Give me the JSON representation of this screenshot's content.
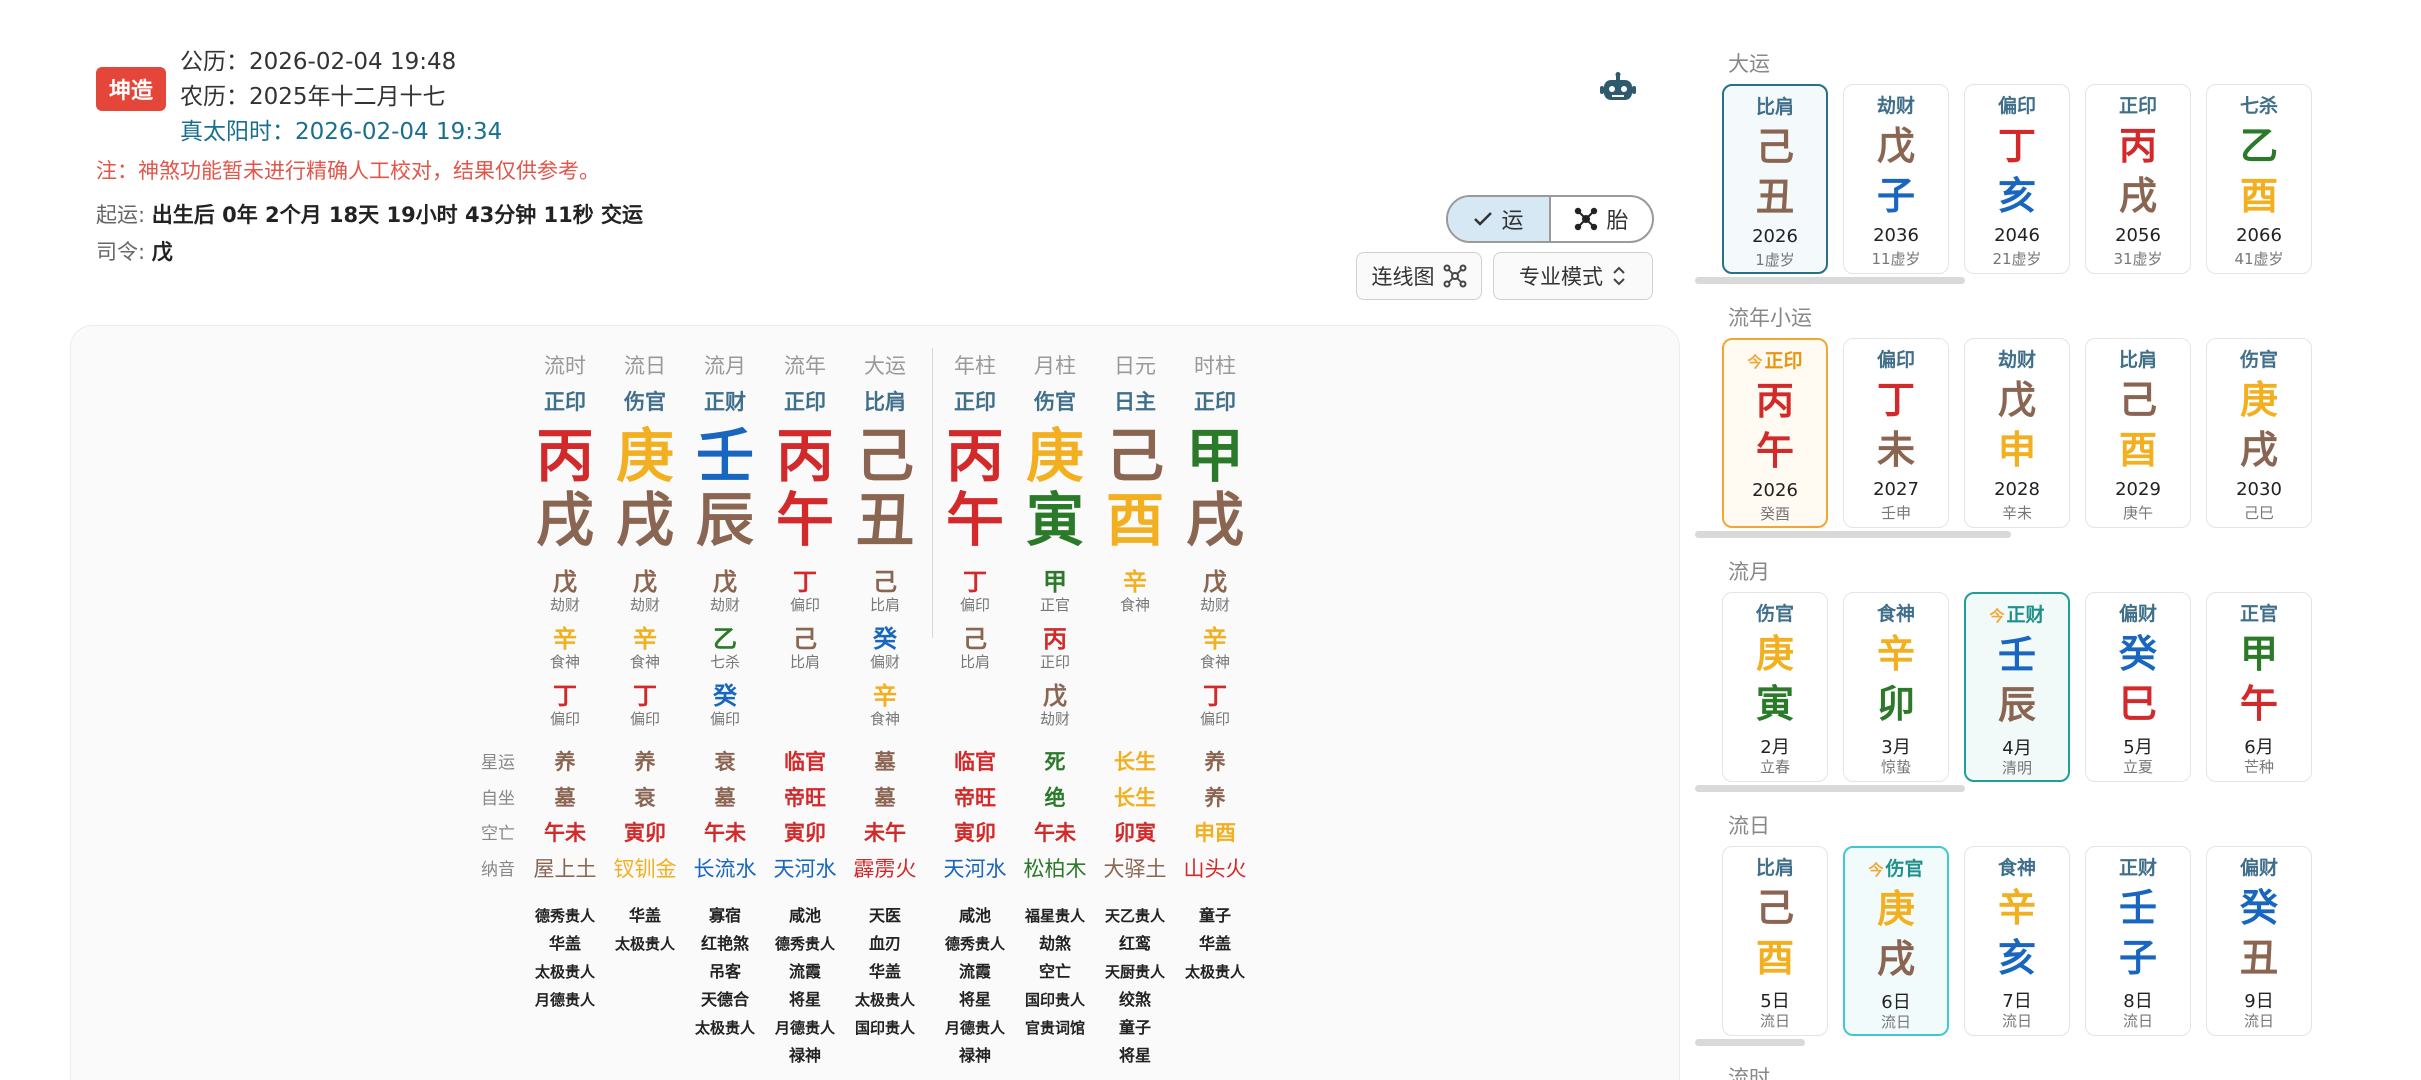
{
  "header": {
    "badge": "坤造",
    "solar": "公历：2026-02-04 19:48",
    "lunar": "农历：2025年十二月十七",
    "true_solar": "真太阳时：2026-02-04 19:34",
    "note": "注：神煞功能暂未进行精确人工校对，结果仅供参考。",
    "qiyun_label": "起运:",
    "qiyun_value": "出生后 0年 2个月 18天 19小时 43分钟 11秒 交运",
    "siling_label": "司令:",
    "siling_value": "戊",
    "robot_icon": "robot-icon",
    "toggle": {
      "yun": "运",
      "tai": "胎"
    },
    "lianxian_label": "连线图",
    "mode_label": "专业模式"
  },
  "chart": {
    "columns": [
      {
        "hdr": "流时",
        "ten": "正印",
        "gan": "丙",
        "gan_c": "fire",
        "zhi": "戌",
        "zhi_c": "earth",
        "hidden": [
          {
            "c": "戊",
            "t": "劫财",
            "e": "earth"
          },
          {
            "c": "辛",
            "t": "食神",
            "e": "metal"
          },
          {
            "c": "丁",
            "t": "偏印",
            "e": "fire"
          }
        ],
        "xingyun": "养",
        "xy_c": "earth",
        "zizuo": "墓",
        "zz_c": "earth",
        "kong": "午未",
        "nayin": "屋上土",
        "ny_c": "earth",
        "shensha": [
          "德秀贵人",
          "华盖",
          "太极贵人",
          "月德贵人"
        ]
      },
      {
        "hdr": "流日",
        "ten": "伤官",
        "gan": "庚",
        "gan_c": "metal",
        "zhi": "戌",
        "zhi_c": "earth",
        "hidden": [
          {
            "c": "戊",
            "t": "劫财",
            "e": "earth"
          },
          {
            "c": "辛",
            "t": "食神",
            "e": "metal"
          },
          {
            "c": "丁",
            "t": "偏印",
            "e": "fire"
          }
        ],
        "xingyun": "养",
        "xy_c": "earth",
        "zizuo": "衰",
        "zz_c": "earth",
        "kong": "寅卯",
        "nayin": "钗钏金",
        "ny_c": "metal",
        "shensha": [
          "华盖",
          "太极贵人"
        ]
      },
      {
        "hdr": "流月",
        "ten": "正财",
        "gan": "壬",
        "gan_c": "water",
        "zhi": "辰",
        "zhi_c": "earth",
        "hidden": [
          {
            "c": "戊",
            "t": "劫财",
            "e": "earth"
          },
          {
            "c": "乙",
            "t": "七杀",
            "e": "wood"
          },
          {
            "c": "癸",
            "t": "偏印",
            "e": "water"
          }
        ],
        "xingyun": "衰",
        "xy_c": "earth",
        "zizuo": "墓",
        "zz_c": "earth",
        "kong": "午未",
        "nayin": "长流水",
        "ny_c": "water",
        "shensha": [
          "寡宿",
          "红艳煞",
          "吊客",
          "天德合",
          "太极贵人"
        ]
      },
      {
        "hdr": "流年",
        "ten": "正印",
        "gan": "丙",
        "gan_c": "fire",
        "zhi": "午",
        "zhi_c": "fire",
        "hidden": [
          {
            "c": "丁",
            "t": "偏印",
            "e": "fire"
          },
          {
            "c": "己",
            "t": "比肩",
            "e": "earth"
          }
        ],
        "xingyun": "临官",
        "xy_c": "fire",
        "zizuo": "帝旺",
        "zz_c": "fire",
        "kong": "寅卯",
        "nayin": "天河水",
        "ny_c": "water",
        "shensha": [
          "咸池",
          "德秀贵人",
          "流霞",
          "将星",
          "月德贵人",
          "禄神"
        ]
      },
      {
        "hdr": "大运",
        "ten": "比肩",
        "gan": "己",
        "gan_c": "earth",
        "zhi": "丑",
        "zhi_c": "earth",
        "hidden": [
          {
            "c": "己",
            "t": "比肩",
            "e": "earth"
          },
          {
            "c": "癸",
            "t": "偏财",
            "e": "water"
          },
          {
            "c": "辛",
            "t": "食神",
            "e": "metal"
          }
        ],
        "xingyun": "墓",
        "xy_c": "earth",
        "zizuo": "墓",
        "zz_c": "earth",
        "kong": "未午",
        "nayin": "霹雳火",
        "ny_c": "fire",
        "shensha": [
          "天医",
          "血刃",
          "华盖",
          "太极贵人",
          "国印贵人"
        ]
      },
      {
        "hdr": "年柱",
        "ten": "正印",
        "gan": "丙",
        "gan_c": "fire",
        "zhi": "午",
        "zhi_c": "fire",
        "hidden": [
          {
            "c": "丁",
            "t": "偏印",
            "e": "fire"
          },
          {
            "c": "己",
            "t": "比肩",
            "e": "earth"
          }
        ],
        "xingyun": "临官",
        "xy_c": "fire",
        "zizuo": "帝旺",
        "zz_c": "fire",
        "kong": "寅卯",
        "nayin": "天河水",
        "ny_c": "water",
        "shensha": [
          "咸池",
          "德秀贵人",
          "流霞",
          "将星",
          "月德贵人",
          "禄神"
        ]
      },
      {
        "hdr": "月柱",
        "ten": "伤官",
        "gan": "庚",
        "gan_c": "metal",
        "zhi": "寅",
        "zhi_c": "wood",
        "hidden": [
          {
            "c": "甲",
            "t": "正官",
            "e": "wood"
          },
          {
            "c": "丙",
            "t": "正印",
            "e": "fire"
          },
          {
            "c": "戊",
            "t": "劫财",
            "e": "earth"
          }
        ],
        "xingyun": "死",
        "xy_c": "wood",
        "zizuo": "绝",
        "zz_c": "wood",
        "kong": "午未",
        "nayin": "松柏木",
        "ny_c": "wood",
        "shensha": [
          "福星贵人",
          "劫煞",
          "空亡",
          "国印贵人",
          "官贵词馆"
        ]
      },
      {
        "hdr": "日元",
        "ten": "日主",
        "gan": "己",
        "gan_c": "earth",
        "zhi": "酉",
        "zhi_c": "metal",
        "hidden": [
          {
            "c": "辛",
            "t": "食神",
            "e": "metal"
          }
        ],
        "xingyun": "长生",
        "xy_c": "metal",
        "zizuo": "长生",
        "zz_c": "metal",
        "kong": "卯寅",
        "nayin": "大驿土",
        "ny_c": "earth",
        "shensha": [
          "天乙贵人",
          "红鸾",
          "天厨贵人",
          "绞煞",
          "童子",
          "将星"
        ]
      },
      {
        "hdr": "时柱",
        "ten": "正印",
        "gan": "甲",
        "gan_c": "wood",
        "zhi": "戌",
        "zhi_c": "earth",
        "hidden": [
          {
            "c": "戊",
            "t": "劫财",
            "e": "earth"
          },
          {
            "c": "辛",
            "t": "食神",
            "e": "metal"
          },
          {
            "c": "丁",
            "t": "偏印",
            "e": "fire"
          }
        ],
        "xingyun": "养",
        "xy_c": "earth",
        "zizuo": "养",
        "zz_c": "earth",
        "kong": "申酉",
        "nayin": "山头火",
        "ny_c": "fire",
        "shensha": [
          "童子",
          "华盖",
          "太极贵人"
        ]
      }
    ],
    "row_labels": {
      "xingyun": "星运",
      "zizuo": "自坐",
      "kong": "空亡",
      "nayin": "纳音"
    }
  },
  "sections": [
    {
      "title": "大运",
      "cards": [
        {
          "ten": "比肩",
          "g1": "己",
          "g1_c": "earth",
          "g2": "丑",
          "g2_c": "earth",
          "yr": "2026",
          "sub": "1虚岁",
          "state": "sel"
        },
        {
          "ten": "劫财",
          "g1": "戊",
          "g1_c": "earth",
          "g2": "子",
          "g2_c": "water",
          "yr": "2036",
          "sub": "11虚岁",
          "state": ""
        },
        {
          "ten": "偏印",
          "g1": "丁",
          "g1_c": "fire",
          "g2": "亥",
          "g2_c": "water",
          "yr": "2046",
          "sub": "21虚岁",
          "state": ""
        },
        {
          "ten": "正印",
          "g1": "丙",
          "g1_c": "fire",
          "g2": "戌",
          "g2_c": "earth",
          "yr": "2056",
          "sub": "31虚岁",
          "state": ""
        },
        {
          "ten": "七杀",
          "g1": "乙",
          "g1_c": "wood",
          "g2": "酉",
          "g2_c": "metal",
          "yr": "2066",
          "sub": "41虚岁",
          "state": ""
        }
      ]
    },
    {
      "title": "流年小运",
      "cards": [
        {
          "ten": "正印",
          "mark": "今",
          "g1": "丙",
          "g1_c": "fire",
          "g2": "午",
          "g2_c": "fire",
          "yr": "2026",
          "sub": "癸酉",
          "state": "today"
        },
        {
          "ten": "偏印",
          "g1": "丁",
          "g1_c": "fire",
          "g2": "未",
          "g2_c": "earth",
          "yr": "2027",
          "sub": "壬申",
          "state": ""
        },
        {
          "ten": "劫财",
          "g1": "戊",
          "g1_c": "earth",
          "g2": "申",
          "g2_c": "metal",
          "yr": "2028",
          "sub": "辛未",
          "state": ""
        },
        {
          "ten": "比肩",
          "g1": "己",
          "g1_c": "earth",
          "g2": "酉",
          "g2_c": "metal",
          "yr": "2029",
          "sub": "庚午",
          "state": ""
        },
        {
          "ten": "伤官",
          "g1": "庚",
          "g1_c": "metal",
          "g2": "戌",
          "g2_c": "earth",
          "yr": "2030",
          "sub": "己巳",
          "state": ""
        }
      ]
    },
    {
      "title": "流月",
      "cards": [
        {
          "ten": "伤官",
          "g1": "庚",
          "g1_c": "metal",
          "g2": "寅",
          "g2_c": "wood",
          "yr": "2月",
          "sub": "立春",
          "state": ""
        },
        {
          "ten": "食神",
          "g1": "辛",
          "g1_c": "metal",
          "g2": "卯",
          "g2_c": "wood",
          "yr": "3月",
          "sub": "惊蛰",
          "state": ""
        },
        {
          "ten": "正财",
          "mark": "今",
          "g1": "壬",
          "g1_c": "water",
          "g2": "辰",
          "g2_c": "earth",
          "yr": "4月",
          "sub": "清明",
          "state": "cur"
        },
        {
          "ten": "偏财",
          "g1": "癸",
          "g1_c": "water",
          "g2": "巳",
          "g2_c": "fire",
          "yr": "5月",
          "sub": "立夏",
          "state": ""
        },
        {
          "ten": "正官",
          "g1": "甲",
          "g1_c": "wood",
          "g2": "午",
          "g2_c": "fire",
          "yr": "6月",
          "sub": "芒种",
          "state": ""
        }
      ]
    },
    {
      "title": "流日",
      "cards": [
        {
          "ten": "比肩",
          "g1": "己",
          "g1_c": "earth",
          "g2": "酉",
          "g2_c": "metal",
          "yr": "5日",
          "sub": "流日",
          "state": ""
        },
        {
          "ten": "伤官",
          "mark": "今",
          "g1": "庚",
          "g1_c": "metal",
          "g2": "戌",
          "g2_c": "earth",
          "yr": "6日",
          "sub": "流日",
          "state": "cur2"
        },
        {
          "ten": "食神",
          "g1": "辛",
          "g1_c": "metal",
          "g2": "亥",
          "g2_c": "water",
          "yr": "7日",
          "sub": "流日",
          "state": ""
        },
        {
          "ten": "正财",
          "g1": "壬",
          "g1_c": "water",
          "g2": "子",
          "g2_c": "water",
          "yr": "8日",
          "sub": "流日",
          "state": ""
        },
        {
          "ten": "偏财",
          "g1": "癸",
          "g1_c": "water",
          "g2": "丑",
          "g2_c": "earth",
          "yr": "9日",
          "sub": "流日",
          "state": ""
        }
      ]
    },
    {
      "title": "流时",
      "cards": []
    }
  ]
}
